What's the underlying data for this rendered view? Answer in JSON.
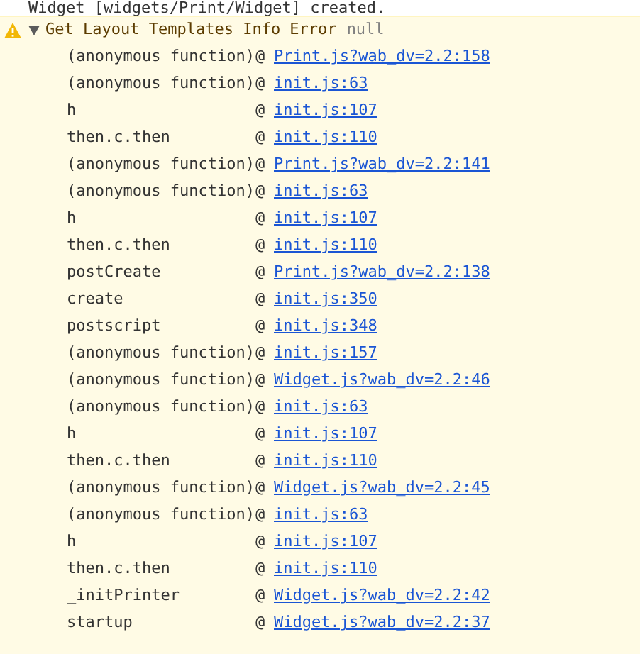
{
  "previous_message": "Widget [widgets/Print/Widget] created.",
  "warning": {
    "message": "Get Layout Templates Info Error",
    "value": "null",
    "expanded": true,
    "stack": [
      {
        "function": "(anonymous function)",
        "separator": "@",
        "location": "Print.js?wab_dv=2.2:158"
      },
      {
        "function": "(anonymous function)",
        "separator": "@",
        "location": "init.js:63"
      },
      {
        "function": "h",
        "separator": "@",
        "location": "init.js:107"
      },
      {
        "function": "then.c.then",
        "separator": "@",
        "location": "init.js:110"
      },
      {
        "function": "(anonymous function)",
        "separator": "@",
        "location": "Print.js?wab_dv=2.2:141"
      },
      {
        "function": "(anonymous function)",
        "separator": "@",
        "location": "init.js:63"
      },
      {
        "function": "h",
        "separator": "@",
        "location": "init.js:107"
      },
      {
        "function": "then.c.then",
        "separator": "@",
        "location": "init.js:110"
      },
      {
        "function": "postCreate",
        "separator": "@",
        "location": "Print.js?wab_dv=2.2:138"
      },
      {
        "function": "create",
        "separator": "@",
        "location": "init.js:350"
      },
      {
        "function": "postscript",
        "separator": "@",
        "location": "init.js:348"
      },
      {
        "function": "(anonymous function)",
        "separator": "@",
        "location": "init.js:157"
      },
      {
        "function": "(anonymous function)",
        "separator": "@",
        "location": "Widget.js?wab_dv=2.2:46"
      },
      {
        "function": "(anonymous function)",
        "separator": "@",
        "location": "init.js:63"
      },
      {
        "function": "h",
        "separator": "@",
        "location": "init.js:107"
      },
      {
        "function": "then.c.then",
        "separator": "@",
        "location": "init.js:110"
      },
      {
        "function": "(anonymous function)",
        "separator": "@",
        "location": "Widget.js?wab_dv=2.2:45"
      },
      {
        "function": "(anonymous function)",
        "separator": "@",
        "location": "init.js:63"
      },
      {
        "function": "h",
        "separator": "@",
        "location": "init.js:107"
      },
      {
        "function": "then.c.then",
        "separator": "@",
        "location": "init.js:110"
      },
      {
        "function": "_initPrinter",
        "separator": "@",
        "location": "Widget.js?wab_dv=2.2:42"
      },
      {
        "function": "startup",
        "separator": "@",
        "location": "Widget.js?wab_dv=2.2:37"
      }
    ]
  }
}
